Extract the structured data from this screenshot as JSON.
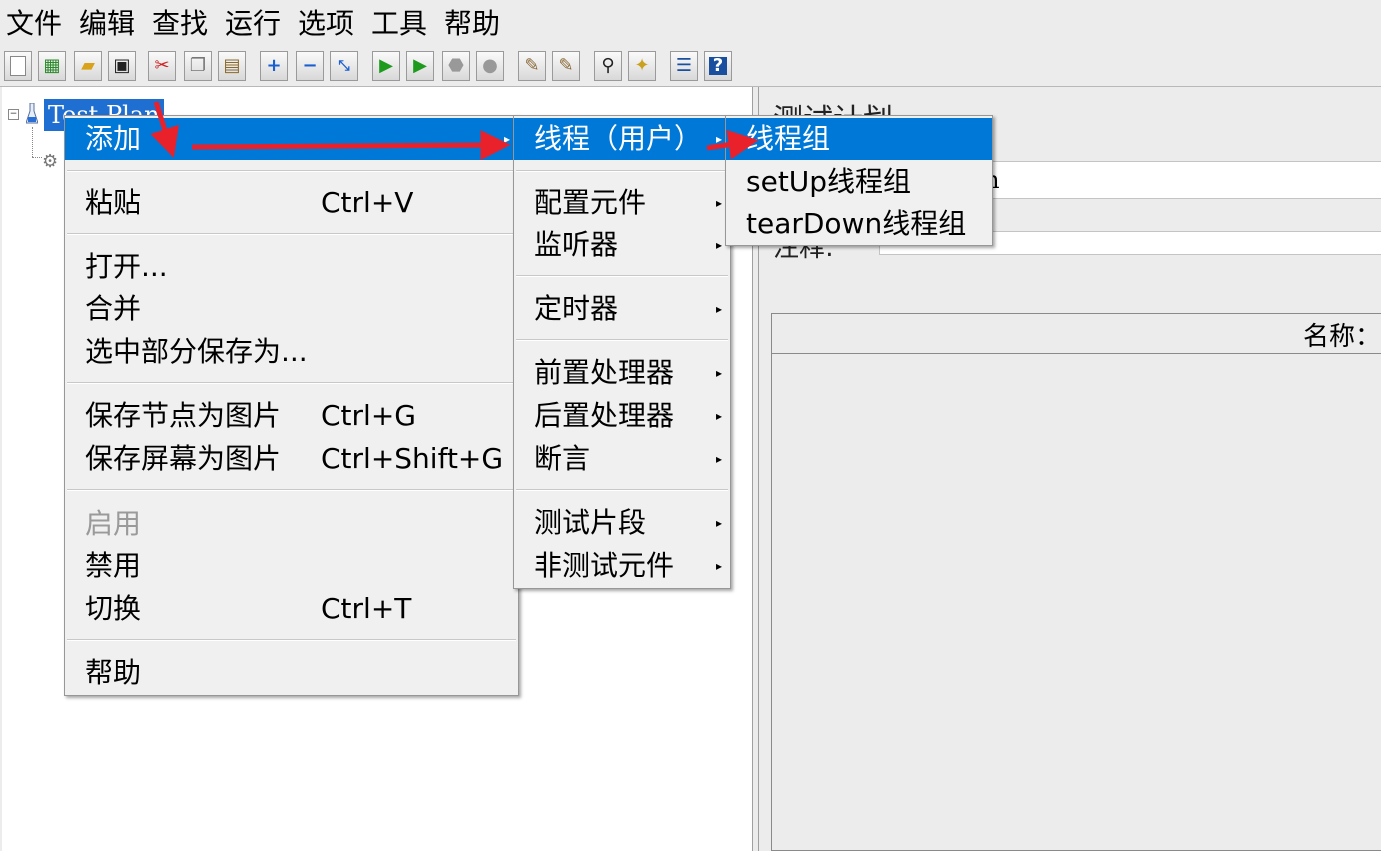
{
  "menubar": [
    "文件",
    "编辑",
    "查找",
    "运行",
    "选项",
    "工具",
    "帮助"
  ],
  "tree": {
    "root_label": "Test Plan",
    "expander": "−"
  },
  "right_pane": {
    "title": "测试计划",
    "name_value": "Test Plan",
    "comment_label": "注释:",
    "table_column": "名称："
  },
  "context_menu": {
    "add": "添加",
    "paste": "粘贴",
    "paste_shortcut": "Ctrl+V",
    "open": "打开...",
    "merge": "合并",
    "save_selection": "选中部分保存为...",
    "save_node_image": "保存节点为图片",
    "save_node_image_shortcut": "Ctrl+G",
    "save_screen_image": "保存屏幕为图片",
    "save_screen_image_shortcut": "Ctrl+Shift+G",
    "enable": "启用",
    "disable": "禁用",
    "toggle": "切换",
    "toggle_shortcut": "Ctrl+T",
    "help": "帮助"
  },
  "add_submenu": {
    "threads": "线程（用户）",
    "config": "配置元件",
    "listener": "监听器",
    "timer": "定时器",
    "pre_processor": "前置处理器",
    "post_processor": "后置处理器",
    "assertion": "断言",
    "test_fragment": "测试片段",
    "non_test": "非测试元件"
  },
  "threads_submenu": {
    "thread_group": "线程组",
    "setup_thread_group": "setUp线程组",
    "teardown_thread_group": "tearDown线程组"
  },
  "toolbar_icons": [
    "new-icon",
    "templates-icon",
    "open-icon",
    "save-icon",
    "cut-icon",
    "copy-icon",
    "paste-icon",
    "expand-icon",
    "collapse-icon",
    "toggle-icon",
    "start-icon",
    "start-no-pause-icon",
    "stop-icon",
    "shutdown-icon",
    "clear-icon",
    "clear-all-icon",
    "search-icon",
    "reset-search-icon",
    "function-helper-icon",
    "help-icon"
  ],
  "colors": {
    "selection": "#0078d7",
    "tree_selection": "#1f6fd2",
    "annotation_arrow": "#e8212b",
    "menu_background": "#f0f0f0"
  }
}
